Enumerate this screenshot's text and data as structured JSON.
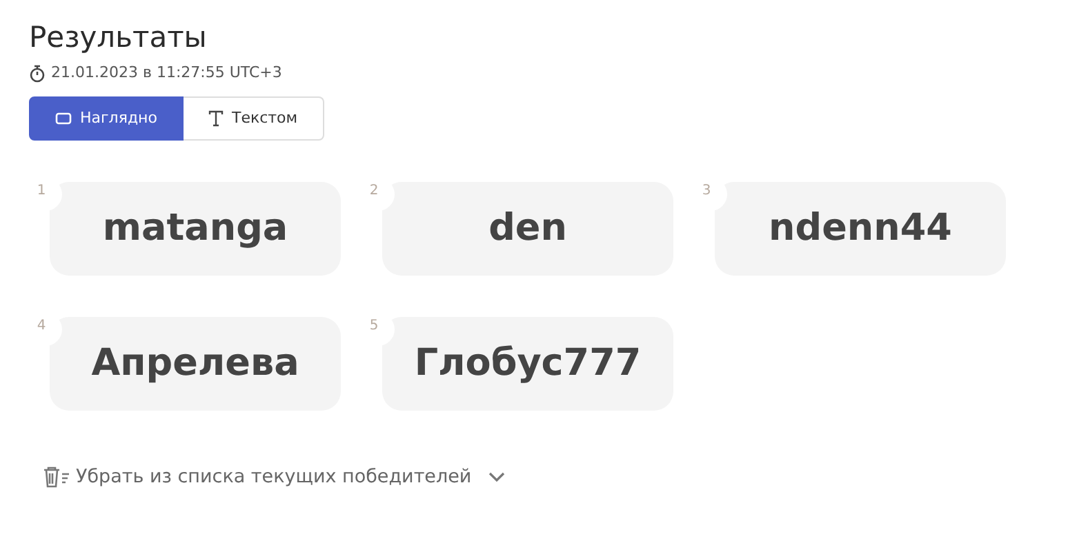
{
  "title": "Результаты",
  "timestamp": "21.01.2023 в 11:27:55 UTC+3",
  "view_tabs": [
    {
      "label": "Наглядно",
      "kind": "visual",
      "selected": true
    },
    {
      "label": "Текстом",
      "kind": "text",
      "selected": false
    }
  ],
  "winners": [
    {
      "number": "1",
      "name": "matanga"
    },
    {
      "number": "2",
      "name": "den"
    },
    {
      "number": "3",
      "name": "ndenn44"
    },
    {
      "number": "4",
      "name": "Апрелева"
    },
    {
      "number": "5",
      "name": "Глобус777"
    }
  ],
  "remove_action": {
    "label": "Убрать из списка текущих победителей"
  }
}
